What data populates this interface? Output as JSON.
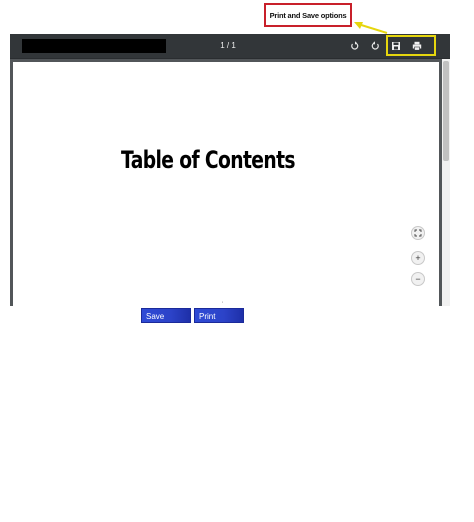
{
  "annotation": {
    "callout_text": "Print and Save options"
  },
  "viewer": {
    "page_indicator": "1 / 1",
    "document_heading": "Table of Contents"
  },
  "buttons": {
    "save_label": "Save",
    "print_label": "Print"
  },
  "colors": {
    "callout_border": "#c8202a",
    "highlight": "#e6d60e",
    "toolbar": "#323639",
    "button_blue": "#2f4bd6"
  },
  "icons": [
    "rotate-counterclockwise-icon",
    "rotate-clockwise-icon",
    "save-icon",
    "print-icon",
    "fit-page-icon",
    "zoom-in-icon",
    "zoom-out-icon"
  ]
}
